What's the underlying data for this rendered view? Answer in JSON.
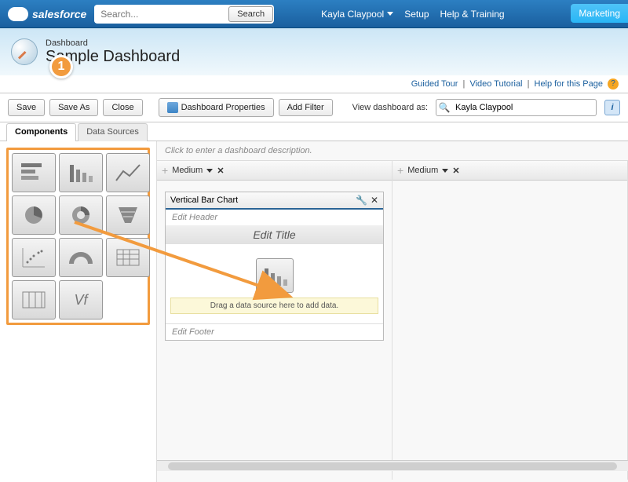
{
  "nav": {
    "brand": "salesforce",
    "search_placeholder": "Search...",
    "search_button": "Search",
    "user": "Kayla Claypool",
    "setup": "Setup",
    "help": "Help & Training",
    "app": "Marketing"
  },
  "page": {
    "crumb": "Dashboard",
    "title": "Sample Dashboard"
  },
  "helpbar": {
    "guided": "Guided Tour",
    "video": "Video Tutorial",
    "helppage": "Help for this Page"
  },
  "toolbar": {
    "save": "Save",
    "save_as": "Save As",
    "close": "Close",
    "dash_props": "Dashboard Properties",
    "add_filter": "Add Filter",
    "view_as": "View dashboard as:",
    "view_user": "Kayla Claypool"
  },
  "tabs": {
    "components": "Components",
    "data_sources": "Data Sources"
  },
  "canvas": {
    "desc_placeholder": "Click to enter a dashboard description.",
    "col_size": "Medium"
  },
  "widget": {
    "name": "Vertical Bar Chart",
    "edit_header": "Edit Header",
    "edit_title": "Edit Title",
    "drop_hint": "Drag a data source here to add data.",
    "edit_footer": "Edit Footer"
  },
  "callout": {
    "number": "1"
  }
}
